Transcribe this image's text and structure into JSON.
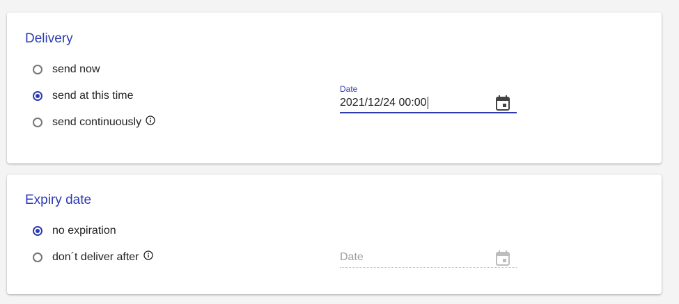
{
  "delivery": {
    "title": "Delivery",
    "options": [
      {
        "label": "send now",
        "checked": false
      },
      {
        "label": "send at this time",
        "checked": true
      },
      {
        "label": "send continuously",
        "checked": false,
        "info_icon": "info-icon"
      }
    ],
    "date_field": {
      "label": "Date",
      "value": "2021/12/24 00:00",
      "icon": "calendar-icon",
      "state": "focused"
    }
  },
  "expiry": {
    "title": "Expiry date",
    "options": [
      {
        "label": "no expiration",
        "checked": true
      },
      {
        "label": "don´t deliver after",
        "checked": false,
        "info_icon": "info-icon"
      }
    ],
    "date_field": {
      "placeholder": "Date",
      "icon": "calendar-icon",
      "state": "disabled"
    }
  },
  "colors": {
    "accent": "#2d3bb0",
    "text": "#212121",
    "disabled": "#9e9e9e",
    "background": "#f4f4f4"
  }
}
